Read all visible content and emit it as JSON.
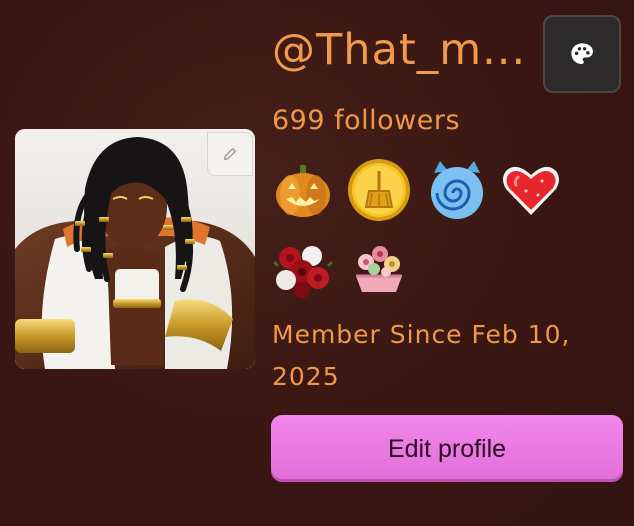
{
  "profile": {
    "username": "@That_m...",
    "followers": "699 followers",
    "member_since": "Member Since Feb 10, 2025",
    "edit_profile_label": "Edit profile"
  },
  "badges": [
    {
      "icon": "jack-o-lantern-icon"
    },
    {
      "icon": "gold-broom-coin-icon"
    },
    {
      "icon": "blue-swirl-cat-icon"
    },
    {
      "icon": "sparkly-heart-icon"
    },
    {
      "icon": "red-rose-bouquet-icon"
    },
    {
      "icon": "flower-basket-icon"
    }
  ],
  "icons": {
    "theme_button": "palette-icon",
    "avatar_edit": "pencil-icon"
  },
  "colors": {
    "background": "#3a1612",
    "accent_text": "#f19a49",
    "button_pink": "#ec7ce2",
    "button_text": "#2b0b26",
    "theme_button_bg": "#2c2a2a"
  }
}
